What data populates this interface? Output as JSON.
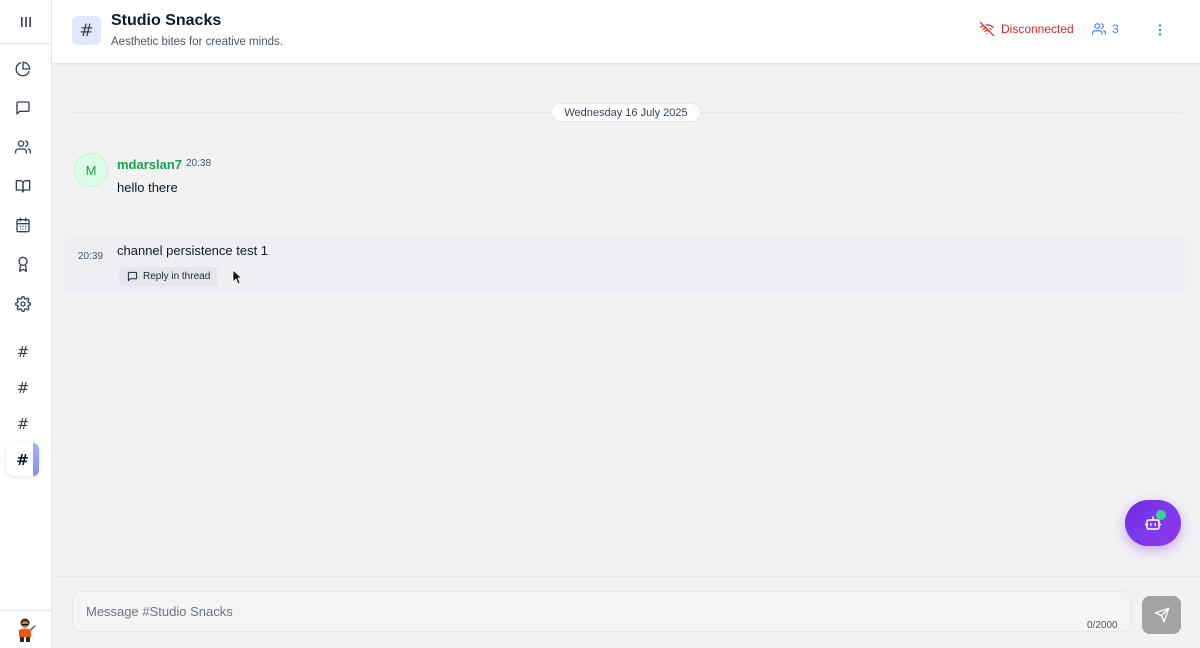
{
  "sidebar": {
    "menu_icon": "menu-icon",
    "nav": [
      {
        "name": "pie-chart-icon"
      },
      {
        "name": "chat-icon"
      },
      {
        "name": "users-icon"
      },
      {
        "name": "book-icon"
      },
      {
        "name": "calendar-icon"
      },
      {
        "name": "award-icon"
      },
      {
        "name": "gear-icon"
      }
    ],
    "channels": [
      "#",
      "#",
      "#",
      "#"
    ],
    "active_channel_index": 3
  },
  "header": {
    "channel_icon": "#",
    "title": "Studio Snacks",
    "subtitle": "Aesthetic bites for creative minds.",
    "status": "Disconnected",
    "member_count": "3"
  },
  "messages": {
    "date_divider": "Wednesday 16 July 2025",
    "items": [
      {
        "avatar_initial": "M",
        "user": "mdarslan7",
        "time": "20:38",
        "text": "hello there"
      },
      {
        "time": "20:39",
        "text": "channel persistence test 1",
        "reply_label": "Reply in thread"
      }
    ]
  },
  "composer": {
    "placeholder": "Message #Studio Snacks",
    "counter": "0/2000"
  },
  "colors": {
    "accent": "#7c3aed",
    "status_error": "#dc2626",
    "user_green": "#16a34a",
    "member_blue": "#3b82f6"
  }
}
